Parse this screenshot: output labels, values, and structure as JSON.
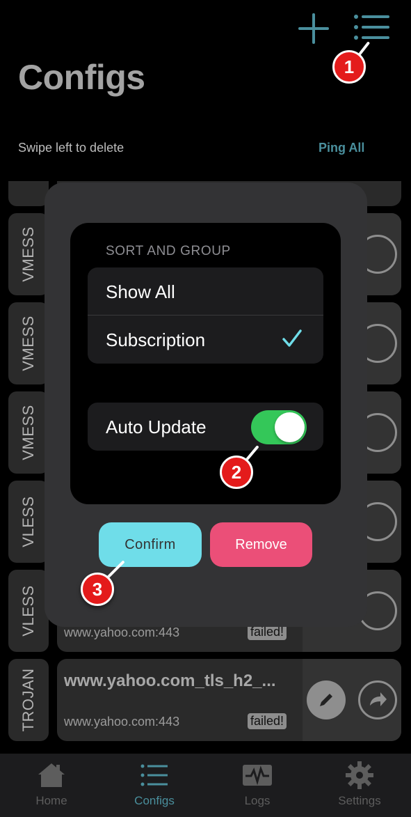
{
  "header": {
    "title": "Configs",
    "hint": "Swipe left to delete",
    "ping_all": "Ping All",
    "add_icon": "plus-icon",
    "menu_icon": "list-menu-icon"
  },
  "list": {
    "rows": [
      {
        "protocol": "VMESS"
      },
      {
        "protocol": "VMESS"
      },
      {
        "protocol": "VMESS"
      },
      {
        "protocol": "VLESS"
      },
      {
        "protocol": "VLESS",
        "host": "www.yahoo.com:443",
        "status": "failed!"
      },
      {
        "protocol": "TROJAN",
        "name": "www.yahoo.com_tls_h2_...",
        "host": "www.yahoo.com:443",
        "status": "failed!"
      }
    ]
  },
  "dialog": {
    "section_header": "SORT AND GROUP",
    "options": [
      {
        "label": "Show All",
        "selected": false
      },
      {
        "label": "Subscription",
        "selected": true
      }
    ],
    "auto_update_label": "Auto Update",
    "auto_update_on": true,
    "confirm_label": "Confirm",
    "remove_label": "Remove"
  },
  "tabs": [
    {
      "label": "Home",
      "icon": "home-icon",
      "active": false
    },
    {
      "label": "Configs",
      "icon": "list-icon",
      "active": true
    },
    {
      "label": "Logs",
      "icon": "activity-icon",
      "active": false
    },
    {
      "label": "Settings",
      "icon": "gear-icon",
      "active": false
    }
  ],
  "callouts": [
    "1",
    "2",
    "3"
  ],
  "colors": {
    "accent": "#4a8f9d",
    "toggle_on": "#34c759",
    "confirm": "#6fdde9",
    "remove": "#eb4f78",
    "callout": "#e41b1b"
  }
}
